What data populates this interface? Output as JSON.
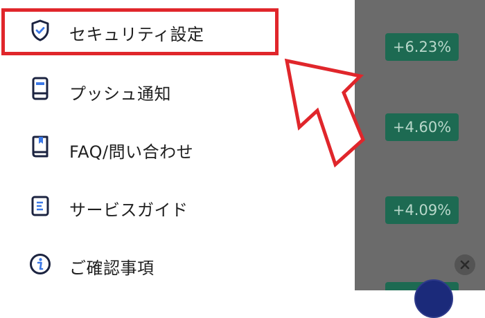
{
  "menu": {
    "items": [
      {
        "label": "セキュリティ設定",
        "icon": "shield-check-icon"
      },
      {
        "label": "プッシュ通知",
        "icon": "smartphone-icon"
      },
      {
        "label": "FAQ/問い合わせ",
        "icon": "book-icon"
      },
      {
        "label": "サービスガイド",
        "icon": "guide-document-icon"
      },
      {
        "label": "ご確認事項",
        "icon": "info-icon"
      }
    ]
  },
  "background": {
    "rates": [
      "+6.23%",
      "+4.60%",
      "+4.09%"
    ]
  },
  "colors": {
    "highlight": "#e0262b",
    "overlay": "#6b6b6b",
    "rate_badge": "#1d6a52",
    "icon_navy": "#1b2340",
    "icon_accent": "#3b78e7"
  }
}
